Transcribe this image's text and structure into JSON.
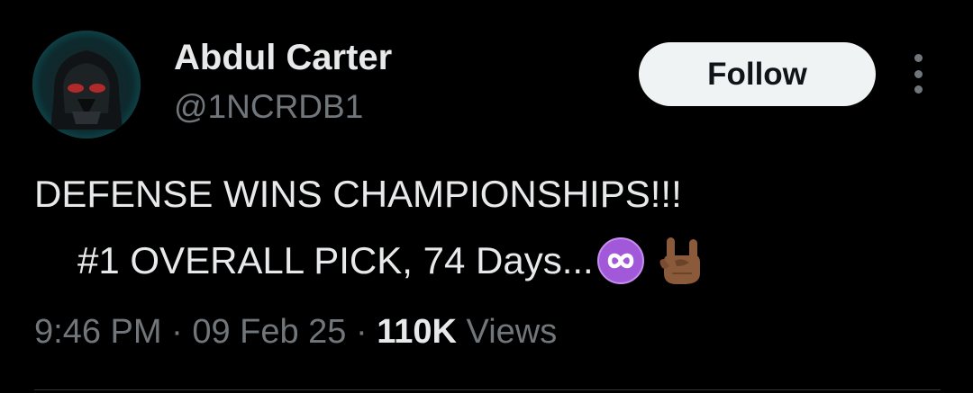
{
  "author": {
    "display_name": "Abdul Carter",
    "handle": "@1NCRDB1",
    "avatar_icon": "darth-vader-helmet-avatar"
  },
  "actions": {
    "follow_label": "Follow",
    "more_icon": "more-vertical-icon"
  },
  "tweet": {
    "line1": "DEFENSE WINS CHAMPIONSHIPS!!!",
    "line2": "#1 OVERALL PICK, 74 Days...",
    "emojis": [
      "infinity-emoji",
      "sign-of-the-horns-emoji"
    ]
  },
  "meta": {
    "time": "9:46 PM",
    "separator": "·",
    "date": "09 Feb 25",
    "views_count": "110K",
    "views_label": "Views"
  },
  "colors": {
    "background": "#000000",
    "primary_text": "#e7e9ea",
    "secondary_text": "#71767b",
    "follow_bg": "#eff3f4",
    "infinity_emoji": "#a259d9"
  }
}
